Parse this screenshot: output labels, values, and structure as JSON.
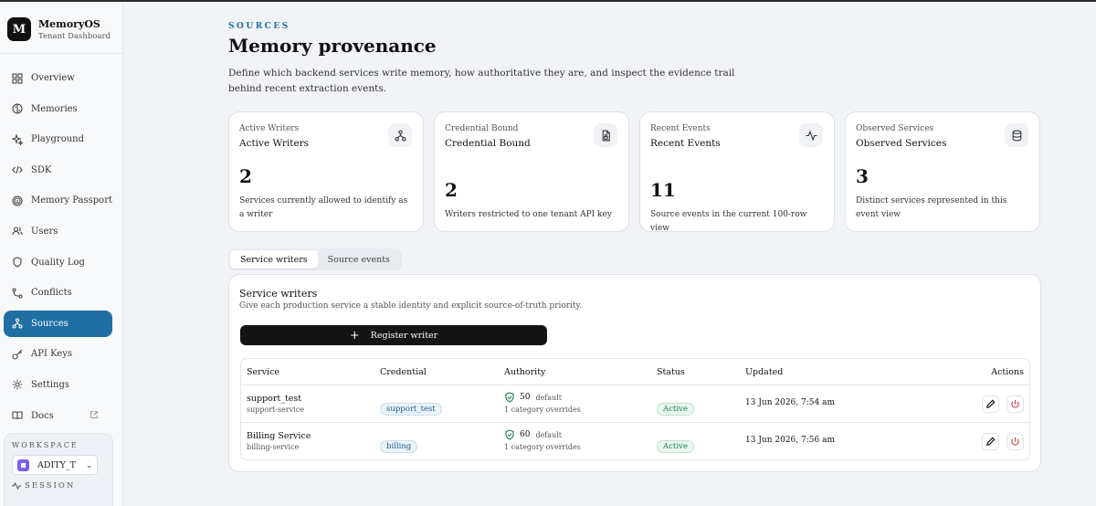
{
  "brand": {
    "logo": "M",
    "name": "MemoryOS",
    "subtitle": "Tenant Dashboard"
  },
  "nav": [
    {
      "label": "Overview",
      "icon": "grid-icon"
    },
    {
      "label": "Memories",
      "icon": "brain-icon"
    },
    {
      "label": "Playground",
      "icon": "sparkles-icon"
    },
    {
      "label": "SDK",
      "icon": "code-icon"
    },
    {
      "label": "Memory Passport",
      "icon": "fingerprint-icon"
    },
    {
      "label": "Users",
      "icon": "users-icon"
    },
    {
      "label": "Quality Log",
      "icon": "shield-icon"
    },
    {
      "label": "Conflicts",
      "icon": "route-icon"
    },
    {
      "label": "Sources",
      "icon": "network-icon",
      "active": true
    },
    {
      "label": "API Keys",
      "icon": "key-icon"
    },
    {
      "label": "Settings",
      "icon": "gear-icon"
    },
    {
      "label": "Docs",
      "icon": "book-icon",
      "external": true
    }
  ],
  "workspace": {
    "label": "WORKSPACE",
    "selected": "ADITY_T",
    "session_label": "SESSION"
  },
  "header": {
    "eyebrow": "SOURCES",
    "title": "Memory provenance",
    "description": "Define which backend services write memory, how authoritative they are, and inspect the evidence trail behind recent extraction events."
  },
  "cards": [
    {
      "small": "Active Writers",
      "label": "Active Writers",
      "value": "2",
      "desc": "Services currently allowed to identify as a writer",
      "icon": "network-icon"
    },
    {
      "small": "Credential Bound",
      "label": "Credential Bound",
      "value": "2",
      "desc": "Writers restricted to one tenant API key",
      "icon": "file-lock-icon"
    },
    {
      "small": "Recent Events",
      "label": "Recent Events",
      "value": "11",
      "desc": "Source events in the current 100-row view",
      "icon": "activity-icon"
    },
    {
      "small": "Observed Services",
      "label": "Observed Services",
      "value": "3",
      "desc": "Distinct services represented in this event view",
      "icon": "database-icon"
    }
  ],
  "tabs": [
    {
      "label": "Service writers",
      "active": true
    },
    {
      "label": "Source events"
    }
  ],
  "panel": {
    "title": "Service writers",
    "subtitle": "Give each production service a stable identity and explicit source-of-truth priority.",
    "register_label": "Register writer"
  },
  "table": {
    "headers": {
      "service": "Service",
      "credential": "Credential",
      "authority": "Authority",
      "status": "Status",
      "updated": "Updated",
      "actions": "Actions"
    },
    "rows": [
      {
        "name": "support_test",
        "id": "support-service",
        "credential": "support_test",
        "authority": "50",
        "authority_label": "default",
        "overrides": "1 category overrides",
        "status": "Active",
        "updated": "13 Jun 2026, 7:54 am"
      },
      {
        "name": "Billing Service",
        "id": "billing-service",
        "credential": "billing",
        "authority": "60",
        "authority_label": "default",
        "overrides": "1 category overrides",
        "status": "Active",
        "updated": "13 Jun 2026, 7:56 am"
      }
    ]
  },
  "colors": {
    "accent": "#1f6fa3",
    "active_green": "#1c7a4c",
    "danger": "#d23a4a"
  }
}
